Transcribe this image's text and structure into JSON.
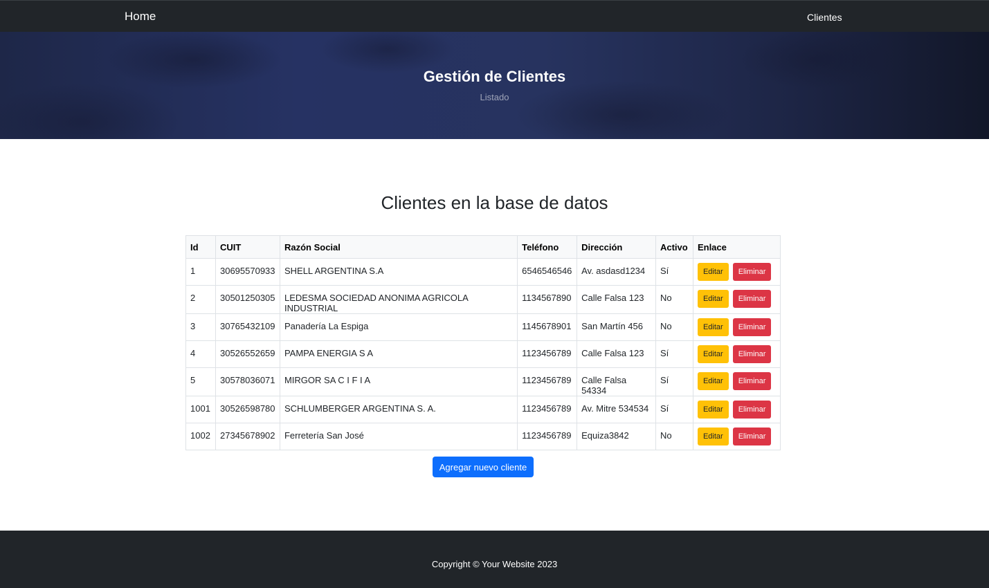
{
  "navbar": {
    "brand": "Home",
    "links": [
      "Clientes"
    ]
  },
  "hero": {
    "title": "Gestión de Clientes",
    "subtitle": "Listado"
  },
  "main": {
    "title": "Clientes en la base de datos",
    "table": {
      "headers": [
        "Id",
        "CUIT",
        "Razón Social",
        "Teléfono",
        "Dirección",
        "Activo",
        "Enlace"
      ],
      "rows": [
        {
          "id": "1",
          "cuit": "30695570933",
          "razon": "SHELL ARGENTINA S.A",
          "telefono": "6546546546",
          "direccion": "Av. asdasd1234",
          "activo": "Sí"
        },
        {
          "id": "2",
          "cuit": "30501250305",
          "razon": "LEDESMA SOCIEDAD ANONIMA AGRICOLA INDUSTRIAL",
          "telefono": "1134567890",
          "direccion": "Calle Falsa 123",
          "activo": "No"
        },
        {
          "id": "3",
          "cuit": "30765432109",
          "razon": "Panadería La Espiga",
          "telefono": "1145678901",
          "direccion": "San Martín 456",
          "activo": "No"
        },
        {
          "id": "4",
          "cuit": "30526552659",
          "razon": "PAMPA ENERGIA S A",
          "telefono": "1123456789",
          "direccion": "Calle Falsa 123",
          "activo": "Sí"
        },
        {
          "id": "5",
          "cuit": "30578036071",
          "razon": "MIRGOR SA C I F I A",
          "telefono": "1123456789",
          "direccion": "Calle Falsa 54334",
          "activo": "Sí"
        },
        {
          "id": "1001",
          "cuit": "30526598780",
          "razon": "SCHLUMBERGER ARGENTINA S. A.",
          "telefono": "1123456789",
          "direccion": "Av. Mitre 534534",
          "activo": "Sí"
        },
        {
          "id": "1002",
          "cuit": "27345678902",
          "razon": "Ferretería San José",
          "telefono": "1123456789",
          "direccion": "Equiza3842",
          "activo": "No"
        }
      ],
      "edit_label": "Editar",
      "delete_label": "Eliminar"
    },
    "add_button": "Agregar nuevo cliente"
  },
  "footer": {
    "text": "Copyright © Your Website 2023"
  },
  "colors": {
    "navbar_bg": "#212529",
    "edit_button": "#ffc107",
    "delete_button": "#dc3545",
    "primary_button": "#0d6efd"
  }
}
